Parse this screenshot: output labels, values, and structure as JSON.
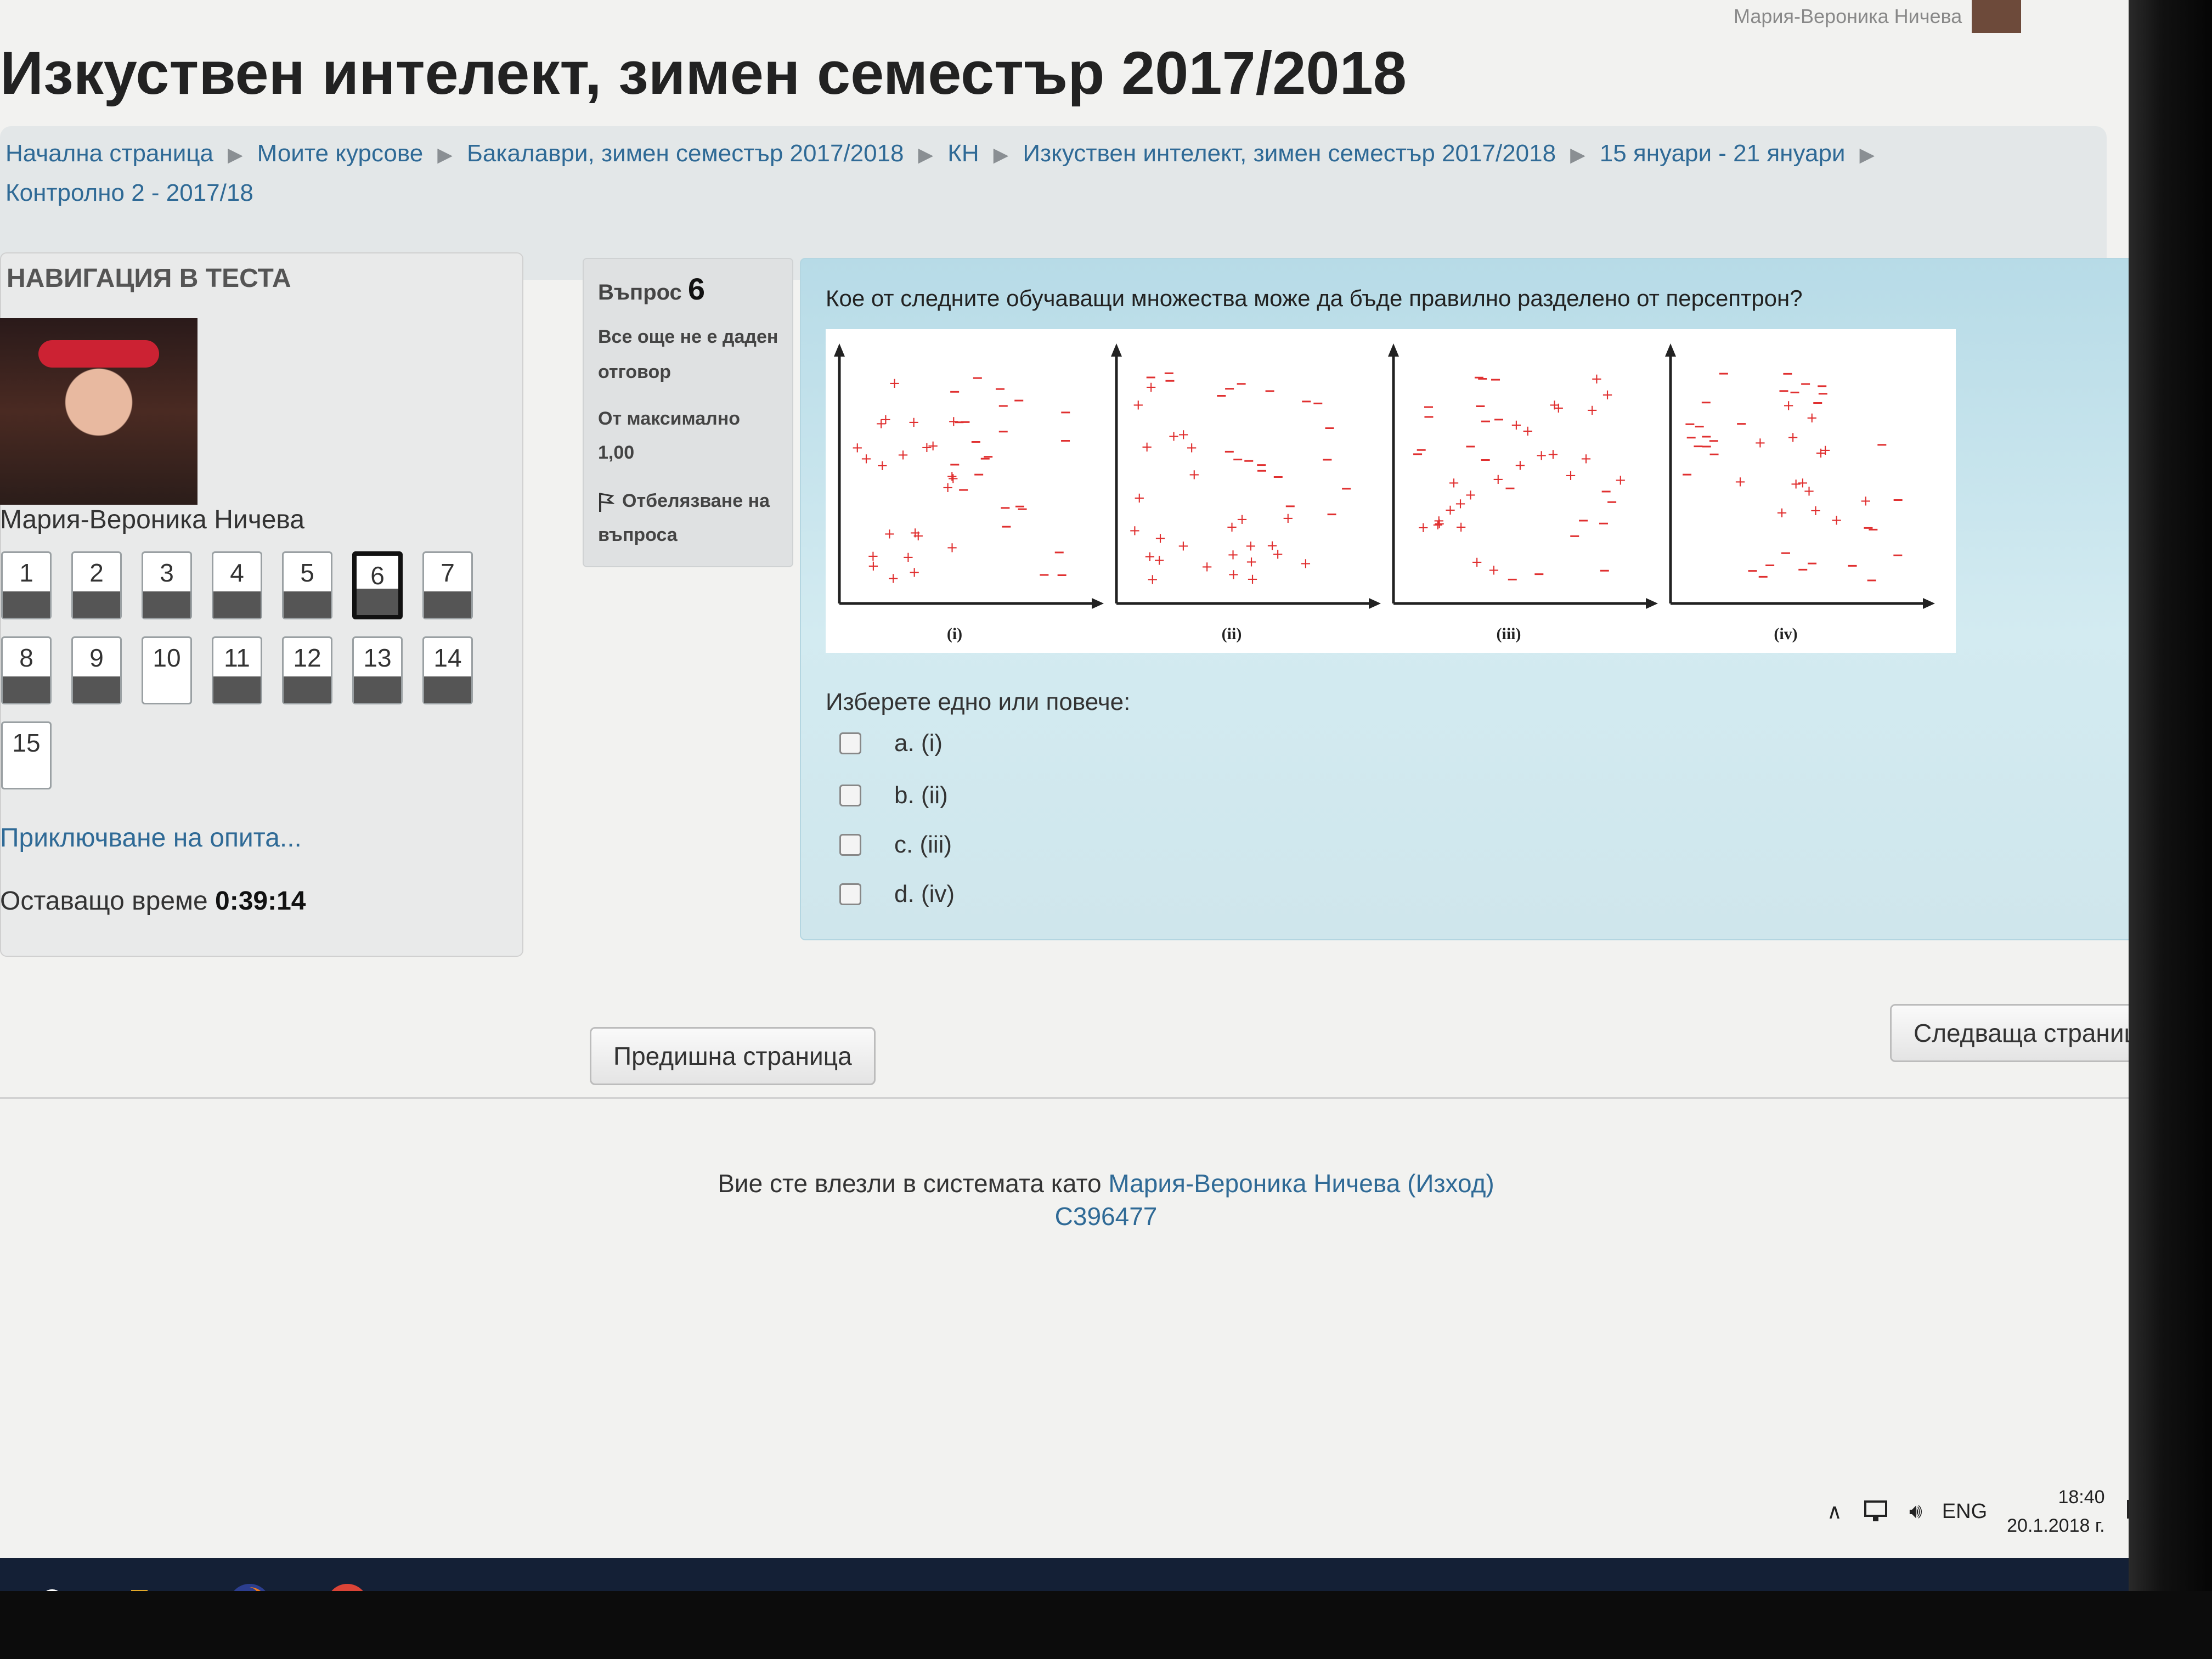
{
  "user_corner": {
    "name": "Мария-Вероника Ничева"
  },
  "page_title": "Изкуствен интелект, зимен семестър 2017/2018",
  "breadcrumb": [
    "Начална страница",
    "Моите курсове",
    "Бакалаври, зимен семестър 2017/2018",
    "КН",
    "Изкуствен интелект, зимен семестър 2017/2018",
    "15 януари - 21 януари",
    "Контролно 2 - 2017/18"
  ],
  "quiz_nav": {
    "title": "НАВИГАЦИЯ В ТЕСТА",
    "user_name": "Мария-Вероника Ничева",
    "questions": [
      {
        "n": "1",
        "state": "answered"
      },
      {
        "n": "2",
        "state": "answered"
      },
      {
        "n": "3",
        "state": "answered"
      },
      {
        "n": "4",
        "state": "answered"
      },
      {
        "n": "5",
        "state": "answered"
      },
      {
        "n": "6",
        "state": "current"
      },
      {
        "n": "7",
        "state": "answered"
      },
      {
        "n": "8",
        "state": "answered"
      },
      {
        "n": "9",
        "state": "answered"
      },
      {
        "n": "10",
        "state": "blank"
      },
      {
        "n": "11",
        "state": "answered"
      },
      {
        "n": "12",
        "state": "answered"
      },
      {
        "n": "13",
        "state": "answered"
      },
      {
        "n": "14",
        "state": "answered"
      },
      {
        "n": "15",
        "state": "blank"
      }
    ],
    "finish_link": "Приключване на опита...",
    "time_label": "Оставащо време",
    "time_value": "0:39:14"
  },
  "question_info": {
    "label": "Въпрос",
    "number": "6",
    "status": "Все още не е даден отговор",
    "max_label": "От максимално",
    "max_value": "1,00",
    "flag": "Отбелязване на въпроса"
  },
  "question": {
    "text": "Кое от следните обучаващи множества може да бъде правилно разделено от персептрон?",
    "plot_labels": [
      "(i)",
      "(ii)",
      "(iii)",
      "(iv)"
    ],
    "choose": "Изберете едно или повече:",
    "options": [
      "a. (i)",
      "b. (ii)",
      "c. (iii)",
      "d. (iv)"
    ]
  },
  "buttons": {
    "prev": "Предишна страница",
    "next": "Следваща страница"
  },
  "footer": {
    "prefix": "Вие сте влезли в системата като",
    "user": "Мария-Вероника Ничева",
    "logout": "(Изход)",
    "code": "C396477"
  },
  "tray": {
    "lang": "ENG",
    "time": "18:40",
    "date": "20.1.2018 г."
  },
  "colors": {
    "link": "#2f6a96",
    "content_bg": "#c8e4ec",
    "plot_points": "#e03030",
    "taskbar": "#142036"
  },
  "icons": [
    "search-icon",
    "file-explorer-icon",
    "firefox-icon",
    "chrome-icon",
    "flag-icon",
    "network-icon",
    "volume-icon",
    "notification-icon"
  ]
}
